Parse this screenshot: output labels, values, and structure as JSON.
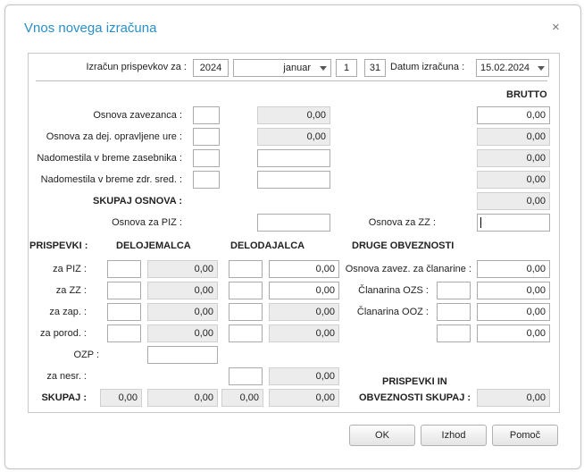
{
  "dialog": {
    "title": "Vnos novega izračuna",
    "close_glyph": "×"
  },
  "header": {
    "calc_label": "Izračun prispevkov za :",
    "year": "2024",
    "month": "januar",
    "day_from": "1",
    "day_to": "31",
    "date_label": "Datum izračuna :",
    "date_value": "15.02.2024"
  },
  "brutto_title": "BRUTTO",
  "osnova": {
    "zavezanca_label": "Osnova zavezanca :",
    "zavezanca_value": "0,00",
    "dej_label": "Osnova za dej. opravljene ure :",
    "dej_value": "0,00",
    "nad_zas_label": "Nadomestila v breme zasebnika :",
    "nad_zdr_label": "Nadomestila v breme zdr. sred. :",
    "skupaj_label": "SKUPAJ OSNOVA :",
    "piz_label": "Osnova za PIZ :",
    "zz_label": "Osnova za ZZ :"
  },
  "brutto_values": [
    "0,00",
    "0,00",
    "0,00",
    "0,00",
    "0,00"
  ],
  "prispevki": {
    "title": "PRISPEVKI :",
    "col_delojemalca": "DELOJEMALCA",
    "col_delodajalca": "DELODAJALCA",
    "col_druge": "DRUGE OBVEZNOSTI",
    "row_piz": "za PIZ :",
    "row_zz": "za ZZ :",
    "row_zap": "za zap. :",
    "row_porod": "za porod. :",
    "row_ozp": "OZP :",
    "row_nesr": "za nesr. :",
    "skupaj": "SKUPAJ :",
    "delojemalca_values": [
      "0,00",
      "0,00",
      "0,00",
      "0,00"
    ],
    "delodajalca_values": [
      "0,00",
      "0,00",
      "0,00",
      "0,00",
      "0,00"
    ],
    "skupaj_rate1": "0,00",
    "skupaj_delojemalca": "0,00",
    "skupaj_rate2": "0,00",
    "skupaj_delodajalca": "0,00"
  },
  "druge": {
    "osnova_clanarine_label": "Osnova zavez. za članarine :",
    "osnova_clanarine_value": "0,00",
    "ozs_label": "Članarina OZS :",
    "ozs_value": "0,00",
    "ooz_label": "Članarina OOZ :",
    "ooz_value": "0,00",
    "extra_value": "0,00",
    "total_label_1": "PRISPEVKI IN",
    "total_label_2": "OBVEZNOSTI SKUPAJ :",
    "total_value": "0,00"
  },
  "buttons": {
    "ok": "OK",
    "izhod": "Izhod",
    "pomoc": "Pomoč"
  }
}
